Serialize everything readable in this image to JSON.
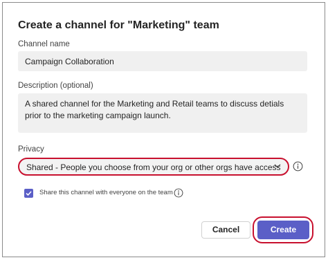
{
  "dialog": {
    "title": "Create a channel for \"Marketing\" team",
    "channel_name": {
      "label": "Channel name",
      "value": "Campaign Collaboration"
    },
    "description": {
      "label": "Description (optional)",
      "value": "A shared channel for the Marketing and Retail teams to discuss detials prior to the marketing campaign launch."
    },
    "privacy": {
      "label": "Privacy",
      "selected": "Shared - People you choose from your org or other orgs have access",
      "info_icon": "info-icon"
    },
    "share_option": {
      "label": "Share this channel with everyone on the team",
      "checked": true,
      "info_icon": "info-icon"
    },
    "buttons": {
      "cancel": "Cancel",
      "create": "Create"
    }
  },
  "colors": {
    "accent": "#5b5fc7",
    "highlight": "#c8102e",
    "field_bg": "#f0f0f0"
  }
}
